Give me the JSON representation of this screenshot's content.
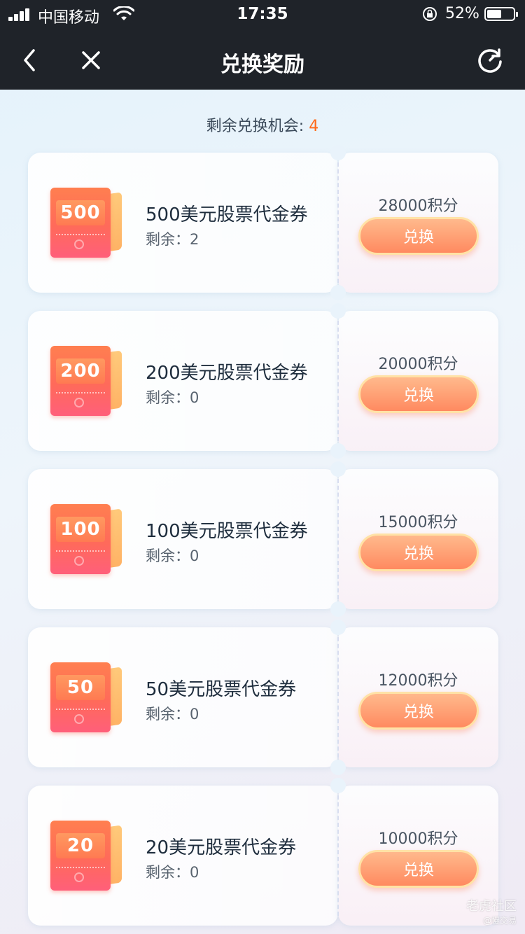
{
  "status_bar": {
    "carrier": "中国移动",
    "time": "17:35",
    "battery_percent": "52%"
  },
  "nav": {
    "title": "兑换奖励",
    "back_icon": "chevron-left-icon",
    "close_icon": "close-icon",
    "refresh_icon": "refresh-icon"
  },
  "summary": {
    "label": "剩余兑换机会: ",
    "count": "4"
  },
  "rewards": [
    {
      "badge": "500",
      "title": "500美元股票代金券",
      "stock": "剩余：2",
      "points": "28000积分",
      "button": "兑换"
    },
    {
      "badge": "200",
      "title": "200美元股票代金券",
      "stock": "剩余：0",
      "points": "20000积分",
      "button": "兑换"
    },
    {
      "badge": "100",
      "title": "100美元股票代金券",
      "stock": "剩余：0",
      "points": "15000积分",
      "button": "兑换"
    },
    {
      "badge": "50",
      "title": "50美元股票代金券",
      "stock": "剩余：0",
      "points": "12000积分",
      "button": "兑换"
    },
    {
      "badge": "20",
      "title": "20美元股票代金券",
      "stock": "剩余：0",
      "points": "10000积分",
      "button": "兑换"
    }
  ],
  "watermark": {
    "main": "老虎社区",
    "sub": "@慢交易"
  },
  "colors": {
    "accent_orange": "#ff6a1a",
    "button_gradient_top": "#ffb98c",
    "button_gradient_bottom": "#ff8a60",
    "nav_background": "#1f2329"
  }
}
